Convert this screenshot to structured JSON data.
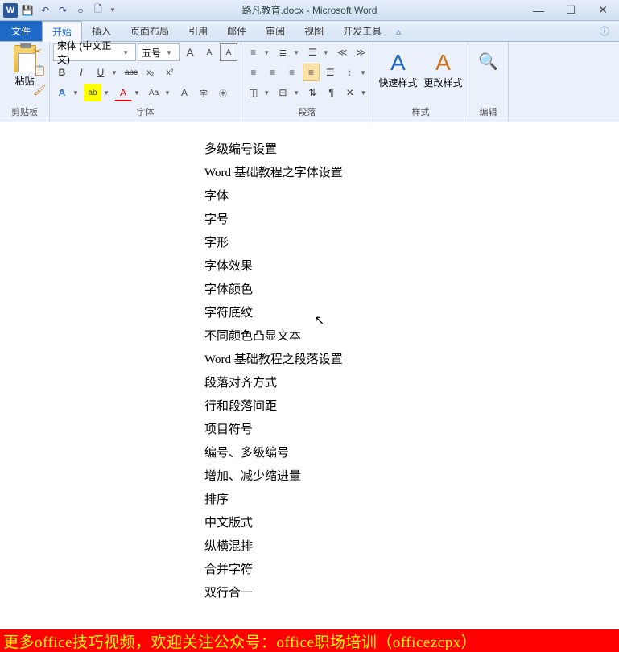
{
  "title": "路凡教育.docx - Microsoft Word",
  "qat": {
    "save": "💾",
    "undo": "↶",
    "redo": "↷",
    "new": "○",
    "open": "🗋"
  },
  "window_controls": {
    "minimize": "—",
    "maximize": "☐",
    "close": "✕"
  },
  "tabs": {
    "file": "文件",
    "items": [
      "开始",
      "插入",
      "页面布局",
      "引用",
      "邮件",
      "审阅",
      "视图",
      "开发工具"
    ],
    "active": 0
  },
  "clipboard": {
    "paste": "粘贴",
    "cut": "✂",
    "copy": "📋",
    "painter": "🖌",
    "label": "剪贴板"
  },
  "font": {
    "family": "宋体 (中文正文)",
    "size": "五号",
    "grow": "A",
    "shrink": "A",
    "clear": "Aa",
    "bold": "B",
    "italic": "I",
    "underline": "U",
    "strike": "abc",
    "sub": "x₂",
    "sup": "x²",
    "effects": "A",
    "highlight": "ab",
    "color": "A",
    "char_border": "A",
    "phonetic": "字",
    "kerning": "Aa",
    "capschange": "Aa",
    "circle": "㊥",
    "label": "字体"
  },
  "paragraph": {
    "list1": "≡",
    "list2": "≣",
    "list3": "☰",
    "indent_dec": "≪",
    "indent_inc": "≫",
    "align_l": "≡",
    "align_c": "≡",
    "align_r": "≡",
    "align_j": "≡",
    "align_d": "☰",
    "line_space": "↕",
    "shading": "◫",
    "border": "⊞",
    "sort": "⇅",
    "showpara": "¶",
    "label": "段落"
  },
  "styles": {
    "quick": "快速样式",
    "change": "更改样式",
    "label": "样式"
  },
  "editing": {
    "label": "编辑",
    "find": "🔍"
  },
  "document_lines": [
    "多级编号设置",
    "Word 基础教程之字体设置",
    "字体",
    "字号",
    "字形",
    "字体效果",
    "字体颜色",
    "字符底纹",
    "不同颜色凸显文本",
    "Word 基础教程之段落设置",
    "段落对齐方式",
    "行和段落间距",
    "项目符号",
    "编号、多级编号",
    "增加、减少缩进量",
    "排序",
    "中文版式",
    "纵横混排",
    "合并字符",
    "双行合一"
  ],
  "banner": "更多office技巧视频，欢迎关注公众号：office职场培训（officezcpx）"
}
